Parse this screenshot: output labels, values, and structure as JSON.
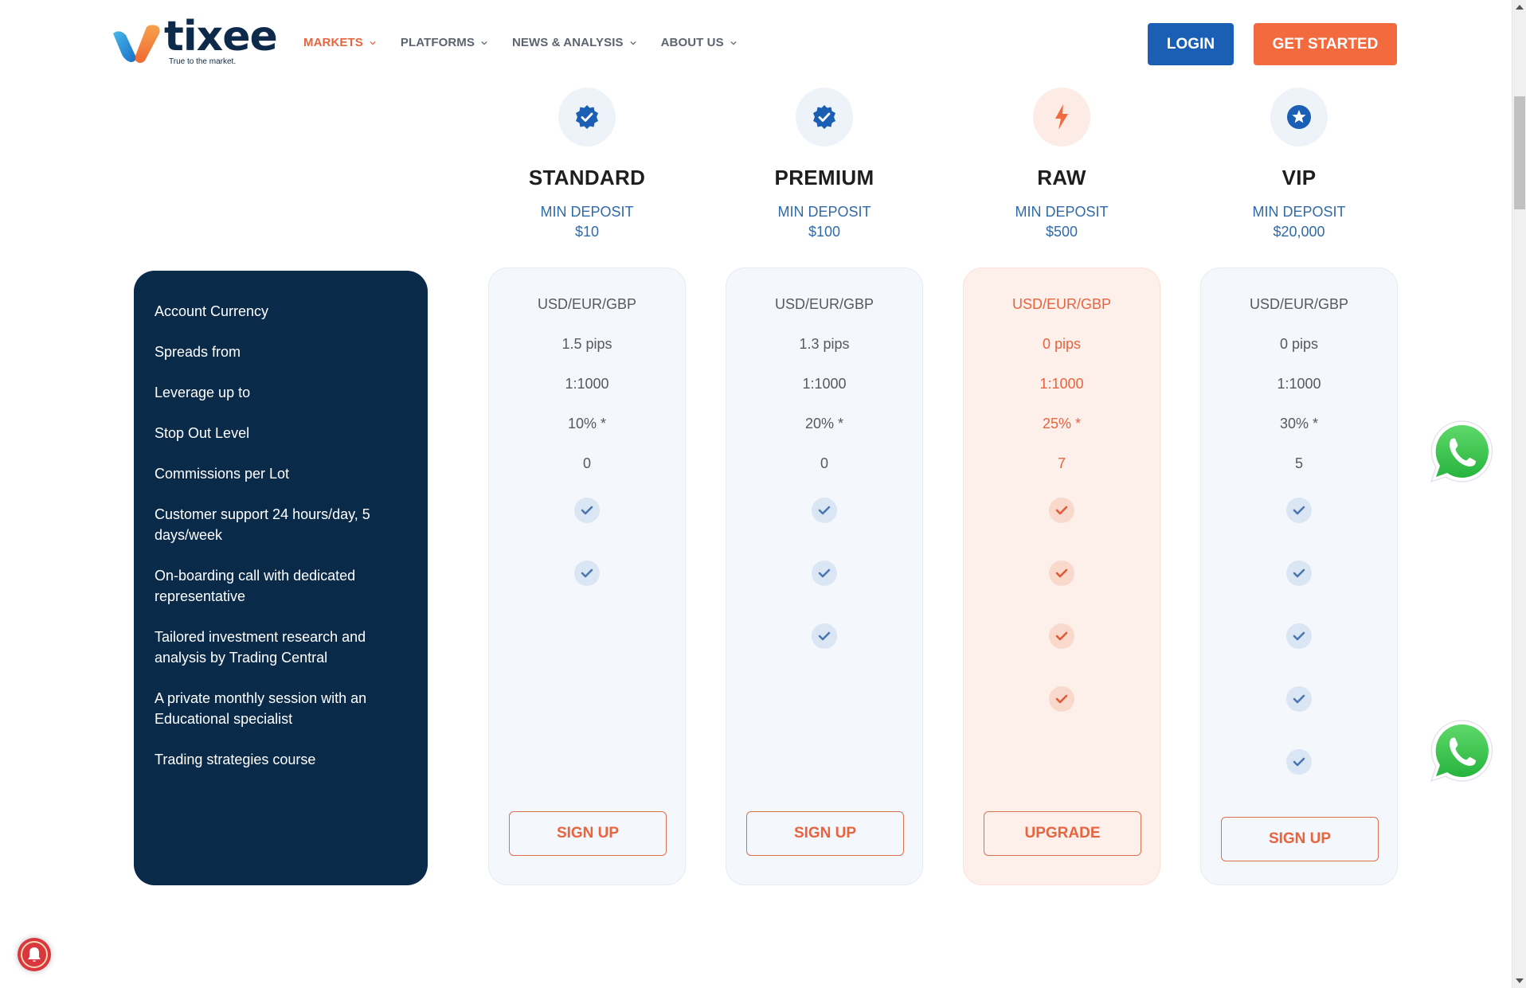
{
  "brand": {
    "name": "tixee",
    "tagline": "True to the market."
  },
  "nav": {
    "items": [
      {
        "label": "MARKETS",
        "active": true
      },
      {
        "label": "PLATFORMS",
        "active": false
      },
      {
        "label": "NEWS & ANALYSIS",
        "active": false
      },
      {
        "label": "ABOUT US",
        "active": false
      }
    ],
    "login_label": "LOGIN",
    "get_started_label": "GET STARTED"
  },
  "colors": {
    "brand_blue": "#1a5fb4",
    "brand_orange": "#f26a3e",
    "panel_navy": "#0a2a4a",
    "deposit_blue": "#2f6aab"
  },
  "features": [
    "Account Currency",
    "Spreads from",
    "Leverage up to",
    "Stop Out Level",
    "Commissions per Lot",
    "Customer support 24 hours/day, 5 days/week",
    "On-boarding call with dedicated representative",
    "Tailored investment research and analysis by Trading Central",
    "A private monthly session with an Educational specialist",
    "Trading strategies course"
  ],
  "plans": [
    {
      "name": "STANDARD",
      "icon": "verified-badge-icon",
      "deposit_label": "MIN DEPOSIT",
      "deposit_value": "$10",
      "currency": "USD/EUR/GBP",
      "spread": "1.5 pips",
      "leverage": "1:1000",
      "stop_out": "10% *",
      "commission": "0",
      "checks": [
        true,
        true,
        false,
        false,
        false
      ],
      "button_label": "SIGN UP"
    },
    {
      "name": "PREMIUM",
      "icon": "verified-badge-icon",
      "deposit_label": "MIN DEPOSIT",
      "deposit_value": "$100",
      "currency": "USD/EUR/GBP",
      "spread": "1.3 pips",
      "leverage": "1:1000",
      "stop_out": "20% *",
      "commission": "0",
      "checks": [
        true,
        true,
        true,
        false,
        false
      ],
      "button_label": "SIGN UP"
    },
    {
      "name": "RAW",
      "icon": "lightning-icon",
      "deposit_label": "MIN DEPOSIT",
      "deposit_value": "$500",
      "currency": "USD/EUR/GBP",
      "spread": "0 pips",
      "leverage": "1:1000",
      "stop_out": "25% *",
      "commission": "7",
      "checks": [
        true,
        true,
        true,
        true,
        false
      ],
      "button_label": "UPGRADE",
      "highlighted": true
    },
    {
      "name": "VIP",
      "icon": "star-badge-icon",
      "deposit_label": "MIN DEPOSIT",
      "deposit_value": "$20,000",
      "currency": "USD/EUR/GBP",
      "spread": "0 pips",
      "leverage": "1:1000",
      "stop_out": "30% *",
      "commission": "5",
      "checks": [
        true,
        true,
        true,
        true,
        true
      ],
      "button_label": "SIGN UP"
    }
  ]
}
